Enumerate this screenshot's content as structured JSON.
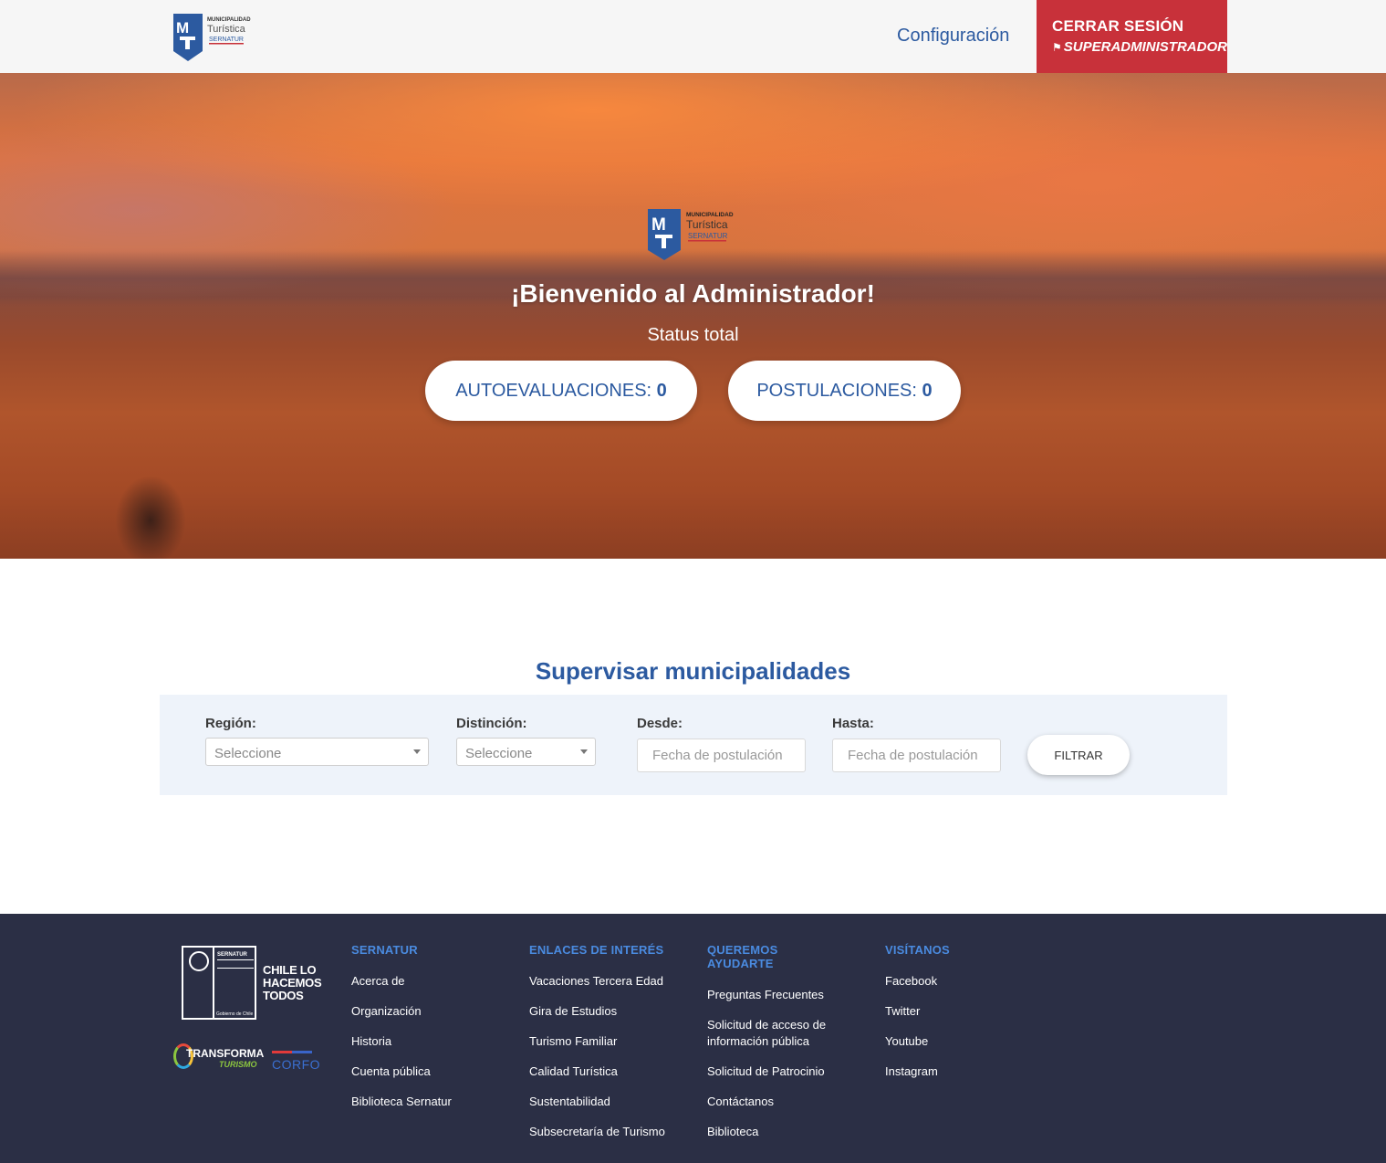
{
  "header": {
    "config_label": "Configuración",
    "logout_label": "CERRAR SESIÓN",
    "user_role": "SUPERADMINISTRADOR"
  },
  "logo": {
    "line1": "MUNICIPALIDAD",
    "line2": "Turística",
    "line3": "SERNATUR",
    "mark": "MT"
  },
  "hero": {
    "welcome": "¡Bienvenido al Administrador!",
    "status_total": "Status total",
    "autoevaluaciones_label": "AUTOEVALUACIONES:",
    "autoevaluaciones_count": "0",
    "postulaciones_label": "POSTULACIONES:",
    "postulaciones_count": "0"
  },
  "supervisar": {
    "title": "Supervisar municipalidades",
    "region_label": "Región:",
    "region_value": "Seleccione",
    "distincion_label": "Distinción:",
    "distincion_value": "Seleccione",
    "desde_label": "Desde:",
    "desde_placeholder": "Fecha de postulación",
    "hasta_label": "Hasta:",
    "hasta_placeholder": "Fecha de postulación",
    "filter_button": "FILTRAR"
  },
  "footer": {
    "brand": {
      "sernatur": "SERNATUR",
      "gobierno": "Gobierno de Chile",
      "chile_line1": "CHILE LO",
      "chile_line2": "HACEMOS",
      "chile_line3": "TODOS",
      "transforma": "TRANSFORMA",
      "turismo": "TURISMO",
      "corfo": "CORFO"
    },
    "columns": [
      {
        "heading": "SERNATUR",
        "links": [
          "Acerca de",
          "Organización",
          "Historia",
          "Cuenta pública",
          "Biblioteca Sernatur"
        ]
      },
      {
        "heading": "ENLACES DE INTERÉS",
        "links": [
          "Vacaciones Tercera Edad",
          "Gira de Estudios",
          "Turismo Familiar",
          "Calidad Turística",
          "Sustentabilidad",
          "Subsecretaría de Turismo"
        ]
      },
      {
        "heading": "QUEREMOS AYUDARTE",
        "links": [
          "Preguntas Frecuentes",
          "Solicitud de acceso de información pública",
          "Solicitud de Patrocinio",
          "Contáctanos",
          "Biblioteca"
        ]
      },
      {
        "heading": "VISÍTANOS",
        "links": [
          "Facebook",
          "Twitter",
          "Youtube",
          "Instagram"
        ]
      }
    ]
  },
  "colors": {
    "primary_blue": "#2c5aa0",
    "logout_red": "#c8313a",
    "footer_bg": "#2b2f45",
    "footer_heading": "#4a8be0",
    "filter_bg": "#eef3fa"
  },
  "icons": {
    "logout_icon": "map-marker-icon",
    "select_icon": "caret-down-icon"
  }
}
